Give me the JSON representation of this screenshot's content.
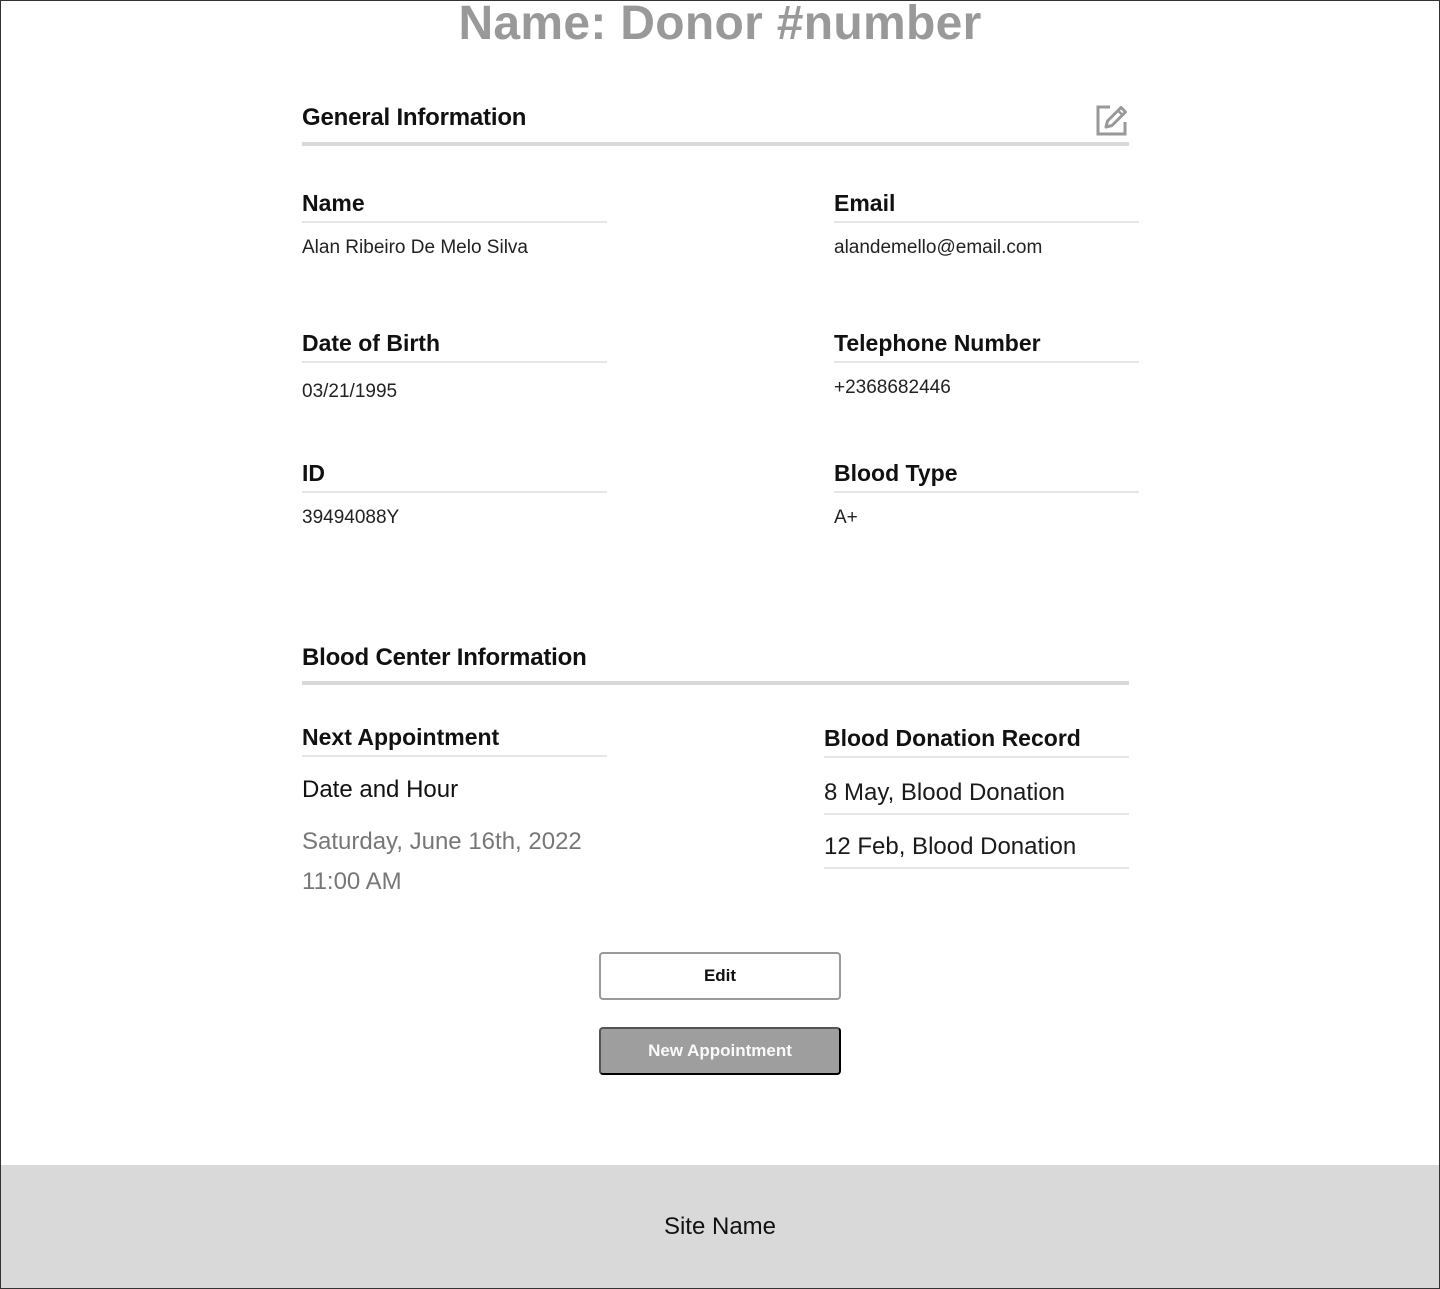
{
  "page": {
    "title": "Name: Donor #number"
  },
  "general": {
    "title": "General Information",
    "edit_icon": "pencil-square-icon",
    "fields": {
      "name": {
        "label": "Name",
        "value": "Alan Ribeiro De Melo Silva"
      },
      "email": {
        "label": "Email",
        "value": "alandemello@email.com"
      },
      "dob": {
        "label": "Date of Birth",
        "value": "03/21/1995"
      },
      "phone": {
        "label": "Telephone Number",
        "value": "+2368682446"
      },
      "id": {
        "label": "ID",
        "value": "39494088Y"
      },
      "blood_type": {
        "label": "Blood Type",
        "value": "A+"
      }
    }
  },
  "blood_center": {
    "title": "Blood Center Information",
    "next_appointment": {
      "label": "Next Appointment",
      "sub_label": "Date and Hour",
      "date": "Saturday, June 16th, 2022",
      "time": "11:00 AM"
    },
    "donation_record": {
      "label": "Blood Donation Record",
      "items": [
        "8 May, Blood Donation",
        "12 Feb, Blood Donation"
      ]
    }
  },
  "actions": {
    "edit_label": "Edit",
    "new_appointment_label": "New Appointment"
  },
  "footer": {
    "site_name": "Site Name"
  },
  "colors": {
    "title_gray": "#999999",
    "rule_gray": "#d9d9d9",
    "footer_bg": "#d9d9d9",
    "primary_button_bg": "#9e9e9e"
  }
}
